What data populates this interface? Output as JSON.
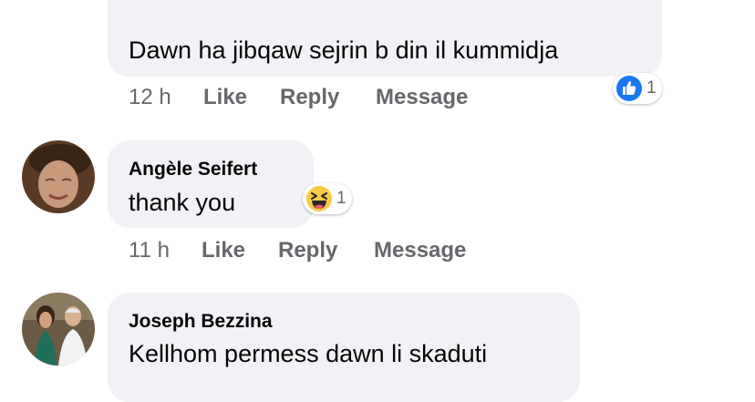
{
  "comments": [
    {
      "text": "Dawn ha jibqaw sejrin b din il kummidja",
      "time": "12 h",
      "like_label": "Like",
      "reply_label": "Reply",
      "message_label": "Message",
      "reaction_icon": "like-icon",
      "reaction_count": "1"
    },
    {
      "author": "Angèle Seifert",
      "text": "thank you",
      "time": "11 h",
      "like_label": "Like",
      "reply_label": "Reply",
      "message_label": "Message",
      "reaction_icon": "haha-icon",
      "reaction_count": "1"
    },
    {
      "author": "Joseph Bezzina",
      "text": "Kellhom permess dawn li skaduti"
    }
  ],
  "colors": {
    "bubble": "#f0f2f5",
    "meta_text": "#65676b",
    "like_blue": "#1877f2",
    "haha_yellow": "#f7c946"
  }
}
